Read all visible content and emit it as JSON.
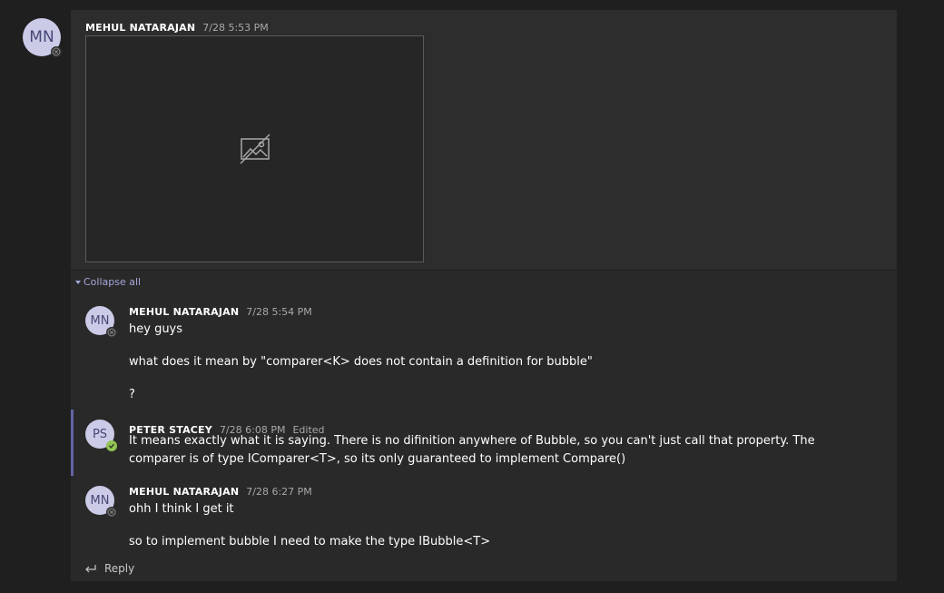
{
  "root_post": {
    "avatar_initials": "MN",
    "author": "MEHUL NATARAJAN",
    "time": "7/28 5:53 PM"
  },
  "collapse_label": "Collapse all",
  "replies": [
    {
      "avatar_initials": "MN",
      "author": "MEHUL NATARAJAN",
      "time": "7/28 5:54 PM",
      "lines": [
        "hey guys",
        "what does it mean by \"comparer<K> does not contain a definition for bubble\"",
        "?"
      ]
    },
    {
      "avatar_initials": "PS",
      "author": "PETER STACEY",
      "time": "7/28 6:08 PM",
      "edited": "Edited",
      "lines": [
        "It means exactly what it is saying. There is no difinition anywhere of Bubble, so you can't just call that property. The comparer is of type IComparer<T>, so its only guaranteed to implement Compare()"
      ]
    },
    {
      "avatar_initials": "MN",
      "author": "MEHUL NATARAJAN",
      "time": "7/28 6:27 PM",
      "lines": [
        "ohh I think I get it",
        "so to implement bubble I need to make the type IBubble<T>"
      ]
    }
  ],
  "reply_label": "Reply",
  "colors": {
    "background": "#1f1f1f",
    "card": "#292929",
    "accent": "#6264a7",
    "link": "#a6a7dc",
    "available": "#92c353"
  },
  "icons": {
    "image": "broken-image-icon",
    "status_offline": "offline-status-icon",
    "status_available": "available-status-icon",
    "reply": "reply-arrow-icon",
    "collapse": "caret-down-icon"
  }
}
